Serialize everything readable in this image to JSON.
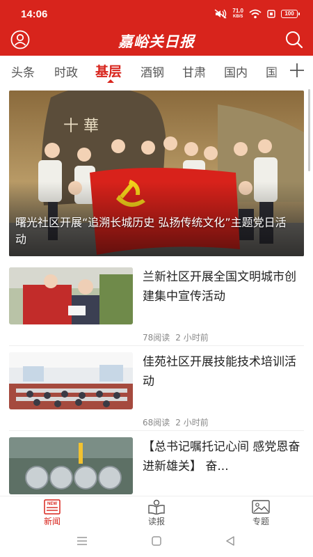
{
  "status_bar": {
    "time": "14:06",
    "net_speed": "71.0",
    "net_unit": "KB/S",
    "battery": "100"
  },
  "header": {
    "brand": "嘉峪关日报",
    "user_icon": "user-icon",
    "search_icon": "search-icon"
  },
  "tabs": [
    {
      "label": "头条"
    },
    {
      "label": "时政"
    },
    {
      "label": "基层"
    },
    {
      "label": "酒钢"
    },
    {
      "label": "甘肃"
    },
    {
      "label": "国内"
    },
    {
      "label": "国"
    }
  ],
  "active_tab": "基层",
  "colors": {
    "brand_red": "#d8241c",
    "meta_gray": "#888888"
  },
  "feed": {
    "hero": {
      "title": "曙光社区开展“追溯长城历史 弘扬传统文化”主题党日活动",
      "banner_text": "十 華"
    },
    "items": [
      {
        "title": "兰新社区开展全国文明城市创建集中宣传活动",
        "reads": "78阅读",
        "time": "2 小时前"
      },
      {
        "title": "佳苑社区开展技能技术培训活动",
        "reads": "68阅读",
        "time": "2 小时前"
      },
      {
        "title": "【总书记嘱托记心间 感党恩奋进新雄关】 奋..."
      }
    ]
  },
  "bottom_nav": {
    "items": [
      {
        "label": "新闻",
        "badge": "NEW"
      },
      {
        "label": "读报"
      },
      {
        "label": "专题"
      }
    ]
  }
}
